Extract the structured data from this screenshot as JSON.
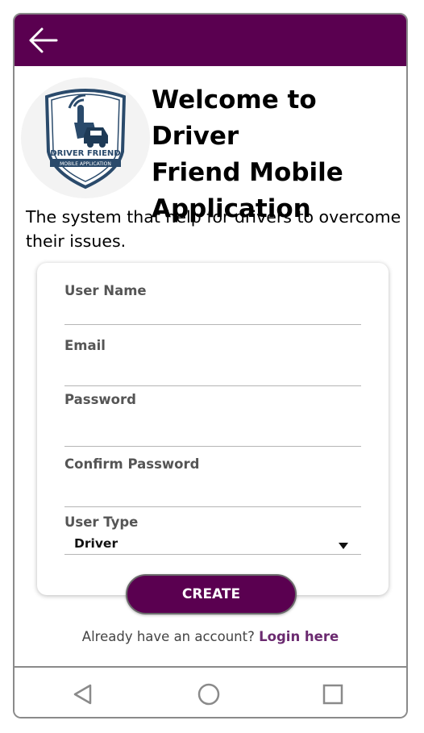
{
  "header": {
    "back_icon": "arrow-left-icon",
    "bar_color": "#5a0050"
  },
  "logo": {
    "line1": "DRIVER FRIEND",
    "line2": "MOBILE APPLICATION"
  },
  "welcome": {
    "title_line1": "Welcome to Driver",
    "title_line2": "Friend Mobile",
    "title_line3": "Application",
    "subtitle": "The system that help for drivers to overcome their issues."
  },
  "form": {
    "username": {
      "label": "User Name",
      "value": ""
    },
    "email": {
      "label": "Email",
      "value": ""
    },
    "password": {
      "label": "Password",
      "value": ""
    },
    "confirm_password": {
      "label": "Confirm Password",
      "value": ""
    },
    "user_type": {
      "label": "User Type",
      "selected": "Driver"
    },
    "create_label": "CREATE"
  },
  "footer": {
    "login_prompt": "Already have an account?",
    "login_link": "Login here"
  },
  "navbar": {
    "back_icon": "triangle-back-icon",
    "home_icon": "circle-home-icon",
    "recents_icon": "square-recents-icon"
  },
  "colors": {
    "accent": "#5a0050",
    "link": "#6b2a70"
  }
}
